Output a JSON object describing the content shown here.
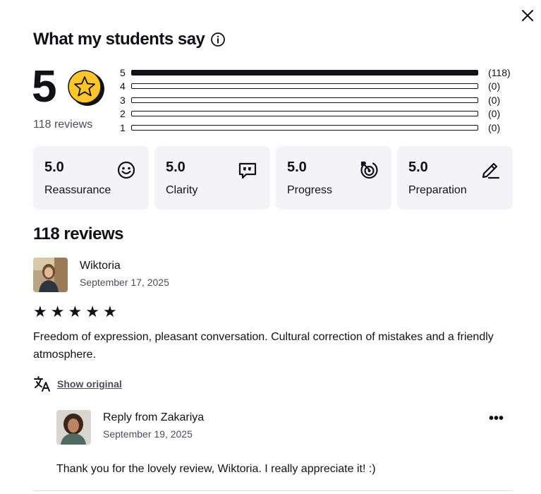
{
  "header": {
    "title": "What my students say"
  },
  "summary": {
    "score": "5",
    "reviews_label": "118 reviews"
  },
  "histogram": [
    {
      "stars": "5",
      "count": "(118)",
      "fraction": 1.0
    },
    {
      "stars": "4",
      "count": "(0)",
      "fraction": 0
    },
    {
      "stars": "3",
      "count": "(0)",
      "fraction": 0
    },
    {
      "stars": "2",
      "count": "(0)",
      "fraction": 0
    },
    {
      "stars": "1",
      "count": "(0)",
      "fraction": 0
    }
  ],
  "categories": [
    {
      "score": "5.0",
      "name": "Reassurance",
      "icon": "smile-icon"
    },
    {
      "score": "5.0",
      "name": "Clarity",
      "icon": "chat-bubble-icon"
    },
    {
      "score": "5.0",
      "name": "Progress",
      "icon": "progress-target-icon"
    },
    {
      "score": "5.0",
      "name": "Preparation",
      "icon": "pencil-icon"
    }
  ],
  "reviews_section": {
    "title": "118 reviews"
  },
  "review": {
    "name": "Wiktoria",
    "date": "September 17, 2025",
    "rating": 5,
    "stars_text": "★ ★ ★ ★ ★",
    "text": "Freedom of expression, pleasant conversation. Cultural correction of mistakes and a friendly atmosphere.",
    "show_original_label": "Show original"
  },
  "reply": {
    "name": "Reply from Zakariya",
    "date": "September 19, 2025",
    "more_label": "•••",
    "text": "Thank you for the lovely review, Wiktoria. I really appreciate it! :)"
  },
  "colors": {
    "text": "#121117",
    "muted": "#4d4c5c",
    "card_bg": "#f4f4f8",
    "star_gold": "#ffc629"
  }
}
